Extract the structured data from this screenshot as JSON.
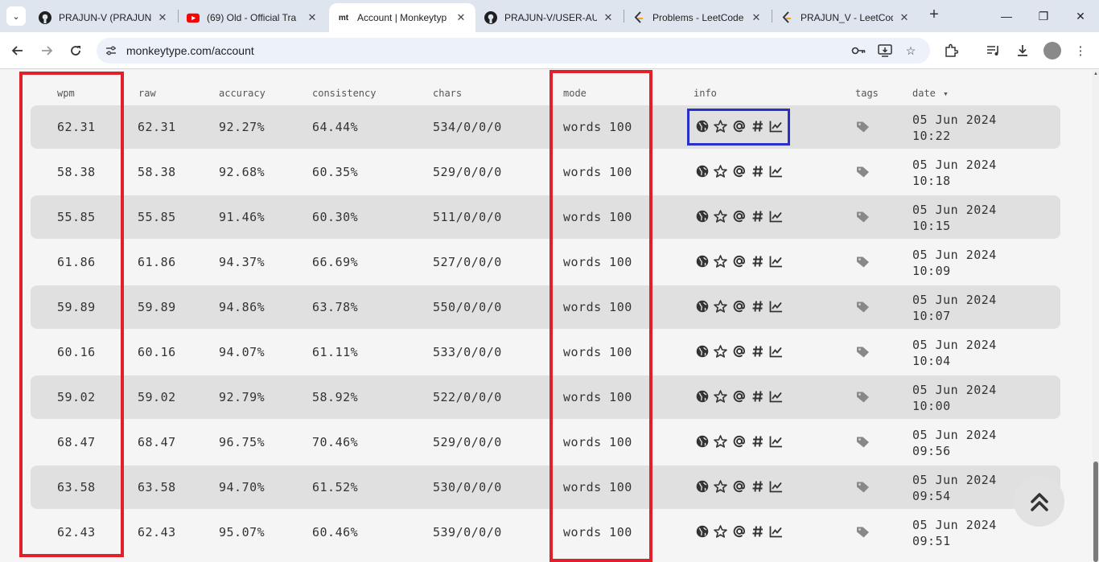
{
  "browser": {
    "tabs": [
      {
        "title": "PRAJUN-V (PRAJUN V",
        "icon": "github-icon"
      },
      {
        "title": "(69) Old - Official Tra",
        "icon": "youtube-icon"
      },
      {
        "title": "Account | Monkeytyp",
        "icon": "monkeytype-icon",
        "favicon_text": "mt"
      },
      {
        "title": "PRAJUN-V/USER-AU",
        "icon": "github-icon"
      },
      {
        "title": "Problems - LeetCode",
        "icon": "leetcode-icon"
      },
      {
        "title": "PRAJUN_V - LeetCod",
        "icon": "leetcode-icon"
      }
    ],
    "url": "monkeytype.com/account"
  },
  "table": {
    "headers": {
      "wpm": "wpm",
      "raw": "raw",
      "accuracy": "accuracy",
      "consistency": "consistency",
      "chars": "chars",
      "mode": "mode",
      "info": "info",
      "tags": "tags",
      "date": "date"
    },
    "sort_indicator": "▾",
    "rows": [
      {
        "wpm": "62.31",
        "raw": "62.31",
        "accuracy": "92.27%",
        "consistency": "64.44%",
        "chars": "534/0/0/0",
        "mode": "words 100",
        "date_line1": "05 Jun 2024",
        "date_line2": "10:22"
      },
      {
        "wpm": "58.38",
        "raw": "58.38",
        "accuracy": "92.68%",
        "consistency": "60.35%",
        "chars": "529/0/0/0",
        "mode": "words 100",
        "date_line1": "05 Jun 2024",
        "date_line2": "10:18"
      },
      {
        "wpm": "55.85",
        "raw": "55.85",
        "accuracy": "91.46%",
        "consistency": "60.30%",
        "chars": "511/0/0/0",
        "mode": "words 100",
        "date_line1": "05 Jun 2024",
        "date_line2": "10:15"
      },
      {
        "wpm": "61.86",
        "raw": "61.86",
        "accuracy": "94.37%",
        "consistency": "66.69%",
        "chars": "527/0/0/0",
        "mode": "words 100",
        "date_line1": "05 Jun 2024",
        "date_line2": "10:09"
      },
      {
        "wpm": "59.89",
        "raw": "59.89",
        "accuracy": "94.86%",
        "consistency": "63.78%",
        "chars": "550/0/0/0",
        "mode": "words 100",
        "date_line1": "05 Jun 2024",
        "date_line2": "10:07"
      },
      {
        "wpm": "60.16",
        "raw": "60.16",
        "accuracy": "94.07%",
        "consistency": "61.11%",
        "chars": "533/0/0/0",
        "mode": "words 100",
        "date_line1": "05 Jun 2024",
        "date_line2": "10:04"
      },
      {
        "wpm": "59.02",
        "raw": "59.02",
        "accuracy": "92.79%",
        "consistency": "58.92%",
        "chars": "522/0/0/0",
        "mode": "words 100",
        "date_line1": "05 Jun 2024",
        "date_line2": "10:00"
      },
      {
        "wpm": "68.47",
        "raw": "68.47",
        "accuracy": "96.75%",
        "consistency": "70.46%",
        "chars": "529/0/0/0",
        "mode": "words 100",
        "date_line1": "05 Jun 2024",
        "date_line2": "09:56"
      },
      {
        "wpm": "63.58",
        "raw": "63.58",
        "accuracy": "94.70%",
        "consistency": "61.52%",
        "chars": "530/0/0/0",
        "mode": "words 100",
        "date_line1": "05 Jun 2024",
        "date_line2": "09:54"
      },
      {
        "wpm": "62.43",
        "raw": "62.43",
        "accuracy": "95.07%",
        "consistency": "60.46%",
        "chars": "539/0/0/0",
        "mode": "words 100",
        "date_line1": "05 Jun 2024",
        "date_line2": "09:51"
      }
    ],
    "info_icons": [
      "globe-icon",
      "star-icon",
      "at-icon",
      "hash-icon",
      "chart-icon"
    ]
  },
  "colors": {
    "annotation_red": "#e0202a",
    "annotation_blue": "#2830c8",
    "row_alt": "#e0e0e0",
    "background": "#f5f5f5"
  }
}
